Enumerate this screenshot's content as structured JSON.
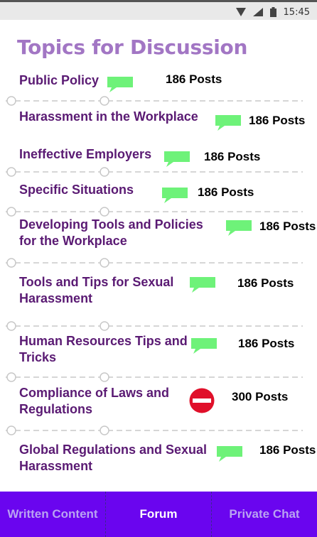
{
  "status_bar": {
    "time": "15:45",
    "icons": [
      "wifi-icon",
      "signal-icon",
      "battery-icon"
    ]
  },
  "page": {
    "title": "Topics for Discussion"
  },
  "colors": {
    "title": "#a276c4",
    "topic_text": "#5a1a73",
    "chat_bubble": "#6ef279",
    "no_entry": "#e0102a",
    "divider": "#c8c8c8",
    "nav_bg": "#6a05ef",
    "nav_active_text": "#ffffff",
    "nav_inactive_text": "#b9a3f2"
  },
  "topics": [
    {
      "title": "Public Policy",
      "count": "186 Posts",
      "icon": "chat-bubble-icon"
    },
    {
      "title": "Harassment in the Workplace",
      "count": "186 Posts",
      "icon": "chat-bubble-icon"
    },
    {
      "title": "Ineffective Employers",
      "count": "186 Posts",
      "icon": "chat-bubble-icon"
    },
    {
      "title": "Specific Situations",
      "count": "186 Posts",
      "icon": "chat-bubble-icon"
    },
    {
      "title": "Developing Tools and Policies for the Workplace",
      "count": "186 Posts",
      "icon": "chat-bubble-icon"
    },
    {
      "title": "Tools and Tips for Sexual Harassment",
      "count": "186 Posts",
      "icon": "chat-bubble-icon"
    },
    {
      "title": "Human Resources Tips and Tricks",
      "count": "186 Posts",
      "icon": "chat-bubble-icon"
    },
    {
      "title": "Compliance of Laws and Regulations",
      "count": "300 Posts",
      "icon": "no-entry-icon"
    },
    {
      "title": "Global Regulations and Sexual Harassment",
      "count": "186 Posts",
      "icon": "chat-bubble-icon"
    }
  ],
  "bottom_nav": {
    "tabs": [
      {
        "label": "Written Content",
        "active": false
      },
      {
        "label": "Forum",
        "active": true
      },
      {
        "label": "Private Chat",
        "active": false
      }
    ]
  }
}
